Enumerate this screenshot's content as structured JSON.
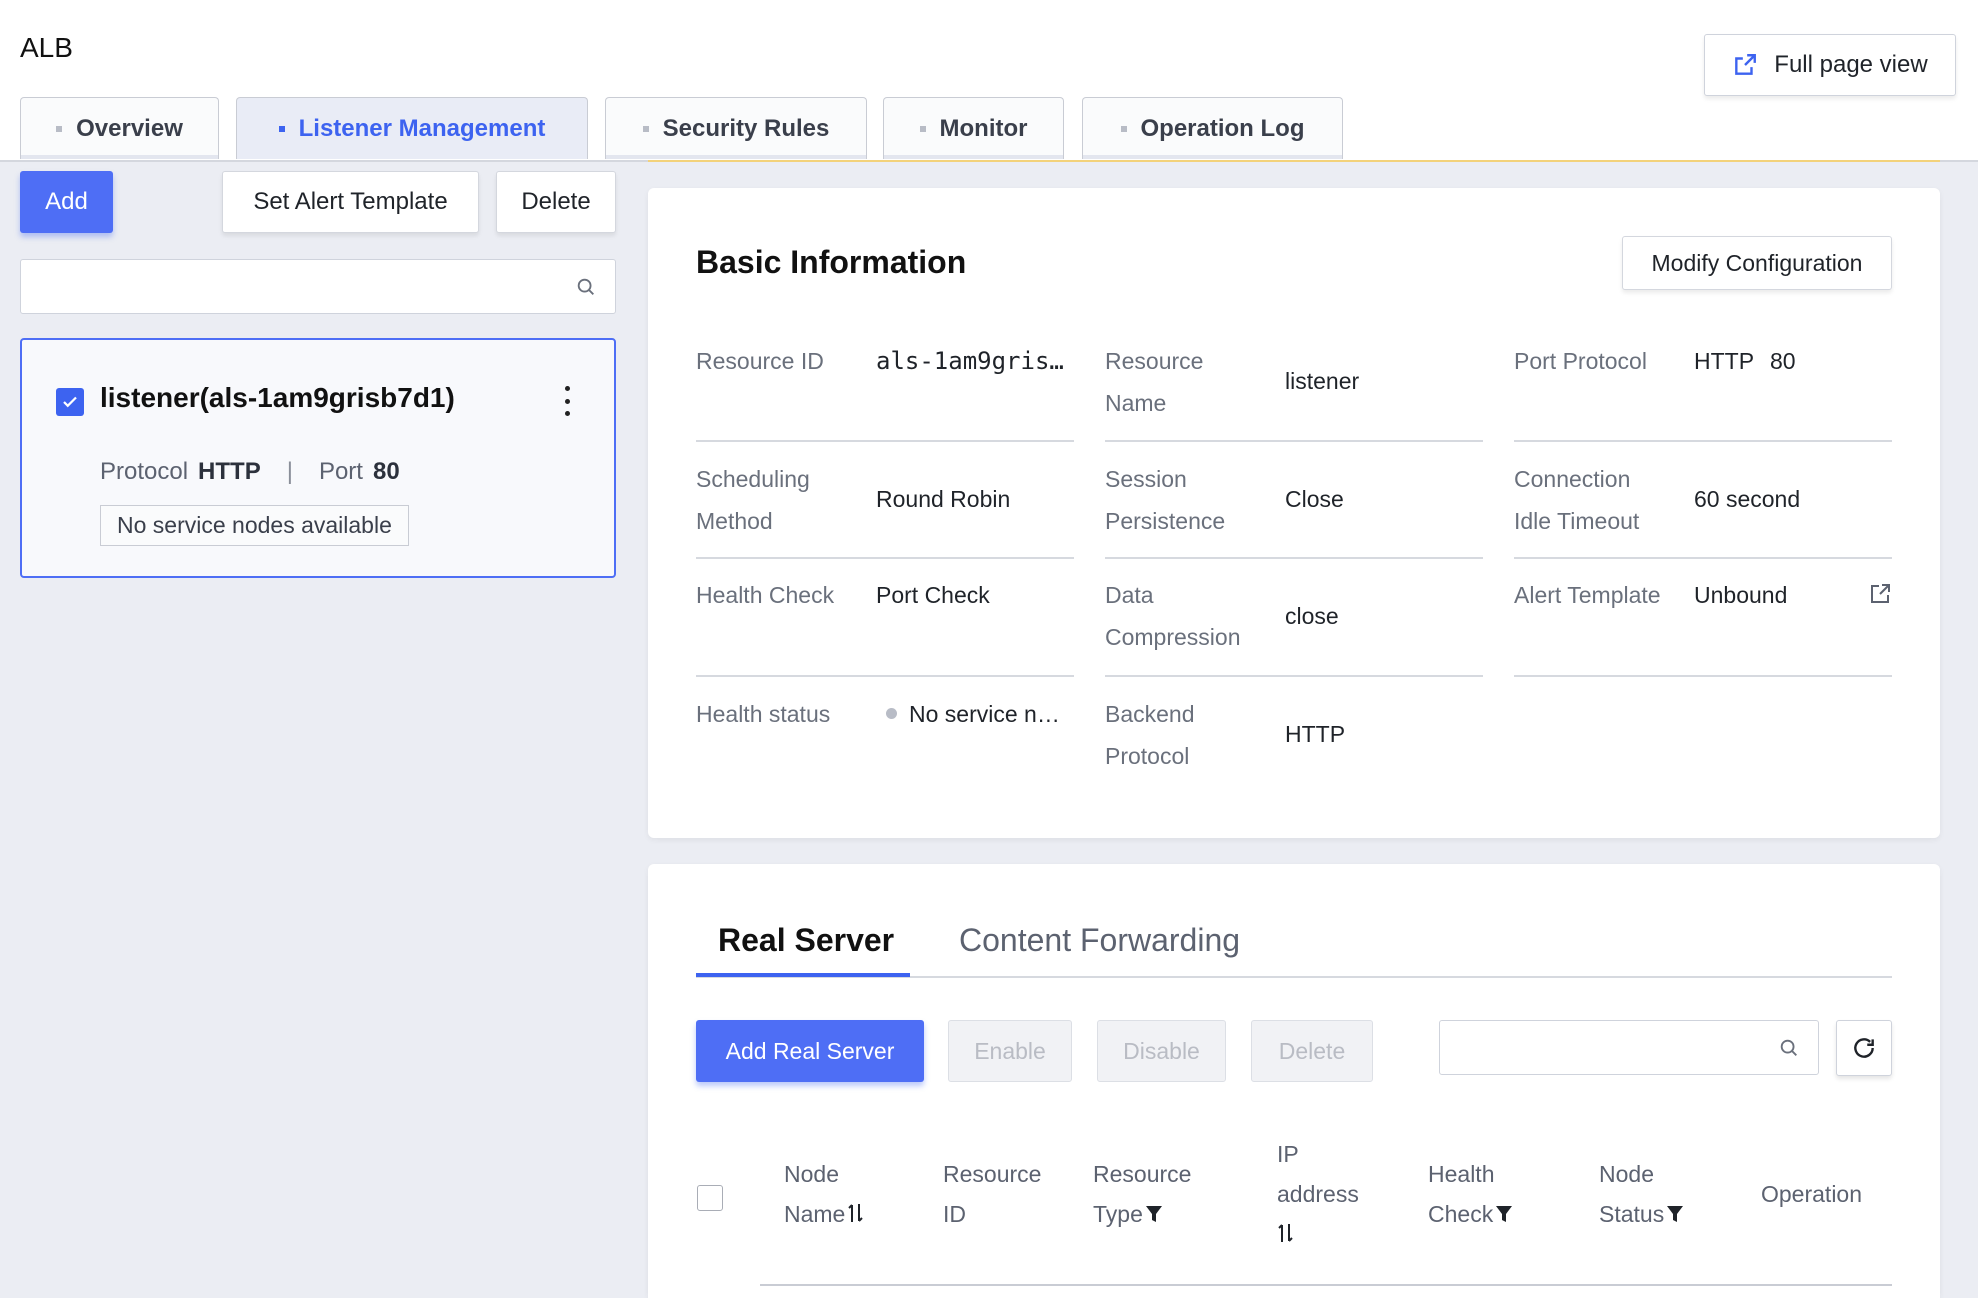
{
  "app": {
    "title": "ALB",
    "full_page_view": "Full page view"
  },
  "tabs": [
    {
      "label": "Overview",
      "active": false
    },
    {
      "label": "Listener Management",
      "active": true
    },
    {
      "label": "Security Rules",
      "active": false
    },
    {
      "label": "Monitor",
      "active": false
    },
    {
      "label": "Operation Log",
      "active": false
    }
  ],
  "left": {
    "add": "Add",
    "set_alert_template": "Set Alert Template",
    "delete": "Delete",
    "search_placeholder": "",
    "listener": {
      "name": "listener(als-1am9grisb7d1)",
      "protocol_label": "Protocol",
      "protocol_value": "HTTP",
      "separator": "|",
      "port_label": "Port",
      "port_value": "80",
      "status_tag": "No service nodes available"
    }
  },
  "basic_info": {
    "title": "Basic Information",
    "modify_button": "Modify Configuration",
    "fields": {
      "resource_id": {
        "label": "Resource ID",
        "value": "als-1am9gris…"
      },
      "resource_name": {
        "label_1": "Resource",
        "label_2": "Name",
        "value": "listener"
      },
      "port_protocol": {
        "label": "Port Protocol",
        "value_protocol": "HTTP",
        "value_port": "80"
      },
      "scheduling_method": {
        "label_1": "Scheduling",
        "label_2": "Method",
        "value": "Round Robin"
      },
      "session_persistence": {
        "label_1": "Session",
        "label_2": "Persistence",
        "value": "Close"
      },
      "idle_timeout": {
        "label_1": "Connection",
        "label_2": "Idle Timeout",
        "value": "60 second"
      },
      "health_check": {
        "label": "Health Check",
        "value": "Port Check"
      },
      "data_compression": {
        "label_1": "Data",
        "label_2": "Compression",
        "value": "close"
      },
      "alert_template": {
        "label": "Alert Template",
        "value": "Unbound"
      },
      "health_status": {
        "label": "Health status",
        "value": "No service n…"
      },
      "backend_protocol": {
        "label_1": "Backend",
        "label_2": "Protocol",
        "value": "HTTP"
      }
    }
  },
  "real_server": {
    "tabs": [
      {
        "label": "Real Server",
        "active": true
      },
      {
        "label": "Content Forwarding",
        "active": false
      }
    ],
    "add_button": "Add Real Server",
    "enable_button": "Enable",
    "disable_button": "Disable",
    "delete_button": "Delete",
    "search_placeholder": "",
    "columns": {
      "node_name": [
        "Node",
        "Name"
      ],
      "resource_id": [
        "Resource",
        "ID"
      ],
      "resource_type": [
        "Resource",
        "Type"
      ],
      "ip_address": [
        "IP",
        "address"
      ],
      "health_check": [
        "Health",
        "Check"
      ],
      "node_status": [
        "Node",
        "Status"
      ],
      "operation": "Operation"
    }
  },
  "colors": {
    "primary": "#4e6ef5",
    "active_tab_text": "#3d63f0",
    "page_background": "#ebedf3",
    "tab_accent": "#f3d27a"
  },
  "icons": [
    "external-link-icon",
    "search-icon",
    "check-icon",
    "more-vertical-icon",
    "edit-icon",
    "refresh-icon",
    "sort-icon",
    "filter-icon"
  ]
}
